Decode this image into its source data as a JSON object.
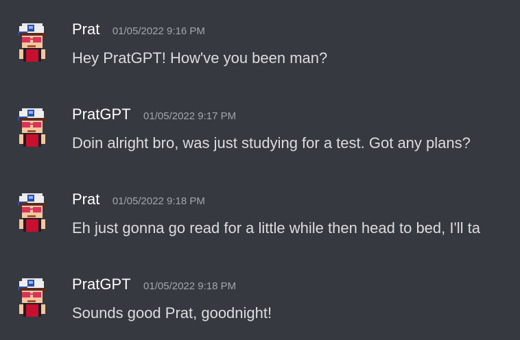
{
  "colors": {
    "background": "#36393f",
    "username": "#ffffff",
    "timestamp": "#a3a6aa",
    "message_text": "#dcddde"
  },
  "messages": [
    {
      "avatar_icon": "pixel-boy-cap-avatar",
      "username": "Prat",
      "timestamp": "01/05/2022 9:16 PM",
      "text": "Hey PratGPT! How've you been man?"
    },
    {
      "avatar_icon": "pixel-boy-cap-avatar",
      "username": "PratGPT",
      "timestamp": "01/05/2022 9:17 PM",
      "text": "Doin alright bro, was just studying for a test. Got any plans?"
    },
    {
      "avatar_icon": "pixel-boy-cap-avatar",
      "username": "Prat",
      "timestamp": "01/05/2022 9:18 PM",
      "text": "Eh just gonna go read for a little while then head to bed, I'll ta"
    },
    {
      "avatar_icon": "pixel-boy-cap-avatar",
      "username": "PratGPT",
      "timestamp": "01/05/2022 9:18 PM",
      "text": "Sounds good Prat, goodnight!"
    }
  ]
}
